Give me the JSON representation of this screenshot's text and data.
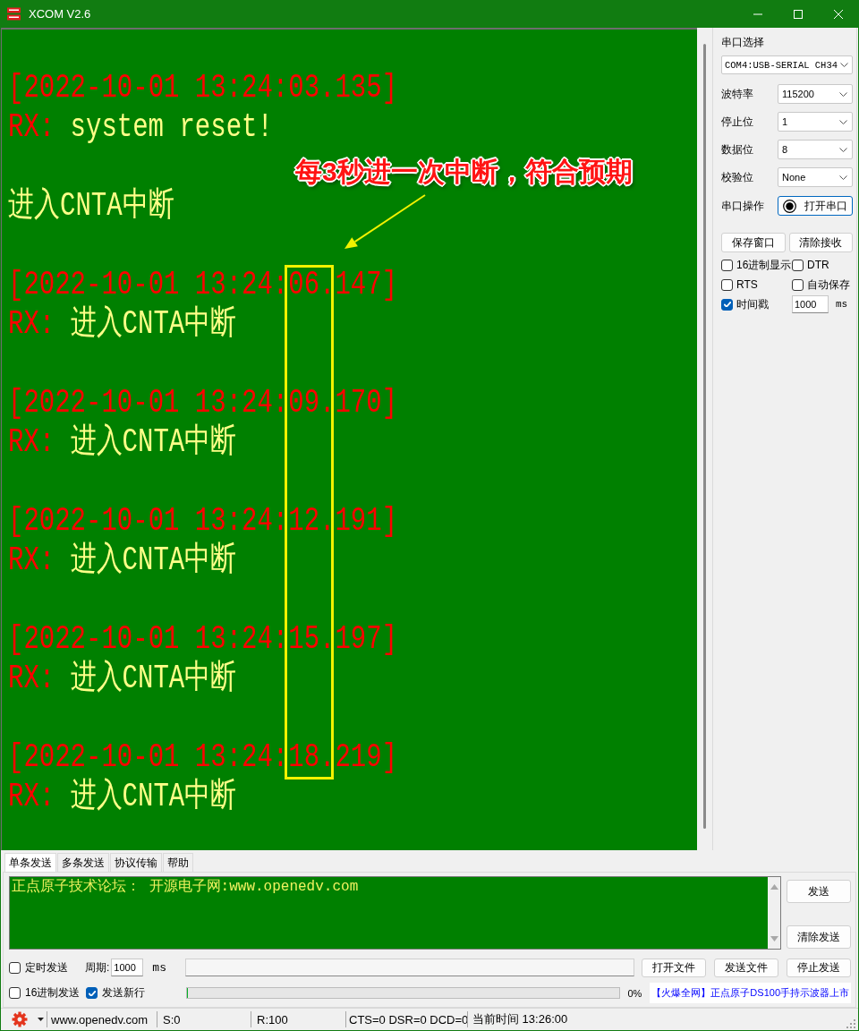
{
  "window": {
    "title": "XCOM V2.6"
  },
  "receive_log": {
    "lines": [
      {
        "kind": "timestamp",
        "text": "[2022-10-01 13:24:03.135]"
      },
      {
        "kind": "rx",
        "prefix": "RX:",
        "text": "system reset!"
      },
      {
        "kind": "plain",
        "text": "进入CNTA中断"
      },
      {
        "kind": "timestamp",
        "text": "[2022-10-01 13:24:06.147]"
      },
      {
        "kind": "rx",
        "prefix": "RX:",
        "text": "进入CNTA中断"
      },
      {
        "kind": "timestamp",
        "text": "[2022-10-01 13:24:09.170]"
      },
      {
        "kind": "rx",
        "prefix": "RX:",
        "text": "进入CNTA中断"
      },
      {
        "kind": "timestamp",
        "text": "[2022-10-01 13:24:12.191]"
      },
      {
        "kind": "rx",
        "prefix": "RX:",
        "text": "进入CNTA中断"
      },
      {
        "kind": "timestamp",
        "text": "[2022-10-01 13:24:15.197]"
      },
      {
        "kind": "rx",
        "prefix": "RX:",
        "text": "进入CNTA中断"
      },
      {
        "kind": "timestamp",
        "text": "[2022-10-01 13:24:18.219]"
      },
      {
        "kind": "rx",
        "prefix": "RX:",
        "text": "进入CNTA中断"
      }
    ]
  },
  "annotation": {
    "text": "每3秒进一次中断，符合预期"
  },
  "serial_panel": {
    "port_label": "串口选择",
    "port": "COM4:USB-SERIAL CH34",
    "settings": [
      {
        "label": "波特率",
        "value": "115200"
      },
      {
        "label": "停止位",
        "value": "1"
      },
      {
        "label": "数据位",
        "value": "8"
      },
      {
        "label": "校验位",
        "value": "None"
      }
    ],
    "operation_label": "串口操作",
    "open_button": "打开串口",
    "buttons": [
      "保存窗口",
      "清除接收"
    ],
    "options": [
      {
        "label": "16进制显示",
        "checked": false
      },
      {
        "label": "DTR",
        "checked": false
      },
      {
        "label": "RTS",
        "checked": false
      },
      {
        "label": "自动保存",
        "checked": false
      },
      {
        "label": "时间戳",
        "checked": true
      }
    ],
    "interval": "1000",
    "interval_unit": "ms"
  },
  "send_tabs": [
    {
      "label": "单条发送",
      "selected": true
    },
    {
      "label": "多条发送",
      "selected": false
    },
    {
      "label": "协议传输",
      "selected": false
    },
    {
      "label": "帮助",
      "selected": false
    }
  ],
  "send_area": {
    "value": "正点原子技术论坛： 开源电子网:www.openedv.com",
    "buttons": [
      "发送",
      "清除发送"
    ]
  },
  "send_options": {
    "timed_send": {
      "label": "定时发送",
      "checked": false
    },
    "period_label": "周期:",
    "period": "1000",
    "period_unit": "ms",
    "file_buttons": [
      "打开文件",
      "发送文件",
      "停止发送"
    ],
    "hex_send": {
      "label": "16进制发送",
      "checked": false
    },
    "send_newline": {
      "label": "发送新行",
      "checked": true
    },
    "progress": {
      "level": 0,
      "reading": "0%"
    },
    "promo_link": "【火爆全网】正点原子DS100手持示波器上市"
  },
  "status_bar": {
    "website": "www.openedv.com",
    "sent": "S:0",
    "received": "R:100",
    "signals": "CTS=0 DSR=0 DCD=0",
    "clock": "当前时间 13:26:00"
  }
}
